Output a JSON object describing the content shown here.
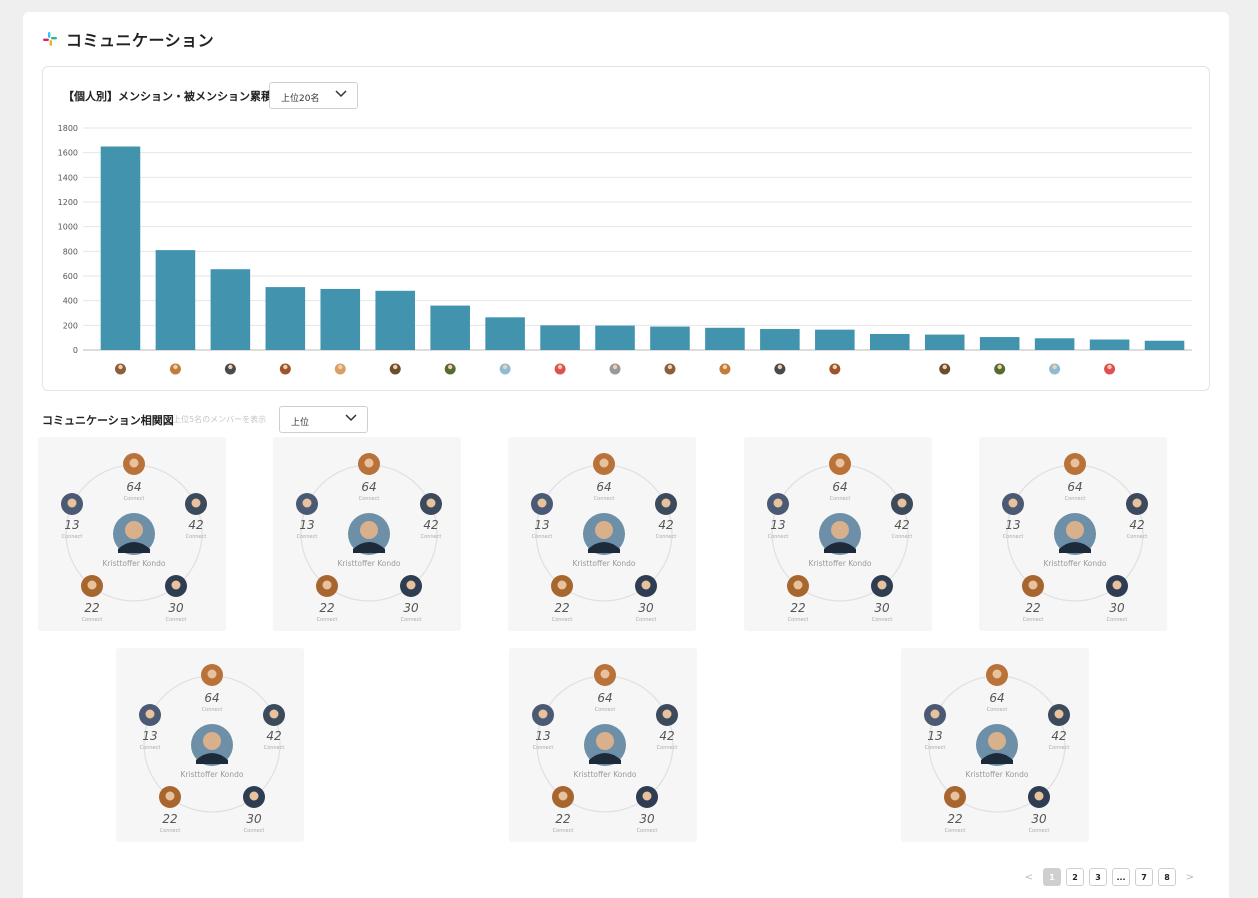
{
  "header": {
    "title": "コミュニケーション",
    "icon": "slack-icon"
  },
  "mention_chart": {
    "title": "【個人別】メンション・被メンション累積",
    "filter": {
      "selected": "上位20名"
    }
  },
  "chart_data": {
    "type": "bar",
    "title": "【個人別】メンション・被メンション累積",
    "categories": [
      "user-1",
      "user-2",
      "user-3",
      "user-4",
      "user-5",
      "user-6",
      "user-7",
      "user-8",
      "user-9",
      "user-10",
      "user-11",
      "user-12",
      "user-13",
      "user-14",
      "user-15",
      "user-16",
      "user-17",
      "user-18",
      "user-19",
      "user-20"
    ],
    "values": [
      1650,
      810,
      655,
      510,
      495,
      480,
      360,
      265,
      200,
      198,
      190,
      180,
      170,
      165,
      130,
      125,
      105,
      95,
      85,
      75
    ],
    "ylim": [
      0,
      1800
    ],
    "yticks": [
      0,
      200,
      400,
      600,
      800,
      1000,
      1200,
      1400,
      1600,
      1800
    ],
    "grid": true,
    "bar_color": "#4293ae",
    "x_tick_markers": "avatar-icon"
  },
  "network_section": {
    "title": "コミュニケーション相関図",
    "hint": "上位5名のメンバーを表示",
    "filter": {
      "selected": "上位"
    }
  },
  "network_card": {
    "center_name": "Kristtoffer Kondo",
    "nodes": [
      {
        "value": "64",
        "label": "Connect"
      },
      {
        "value": "42",
        "label": "Connect"
      },
      {
        "value": "30",
        "label": "Connect"
      },
      {
        "value": "22",
        "label": "Connect"
      },
      {
        "value": "13",
        "label": "Connect"
      }
    ]
  },
  "pagination": {
    "prev": "<",
    "pages": [
      "1",
      "2",
      "3",
      "...",
      "7",
      "8"
    ],
    "next": ">",
    "current": "1"
  },
  "colors": {
    "bar": "#4293ae",
    "panel_bg": "#ffffff",
    "page_bg": "#efefef"
  }
}
